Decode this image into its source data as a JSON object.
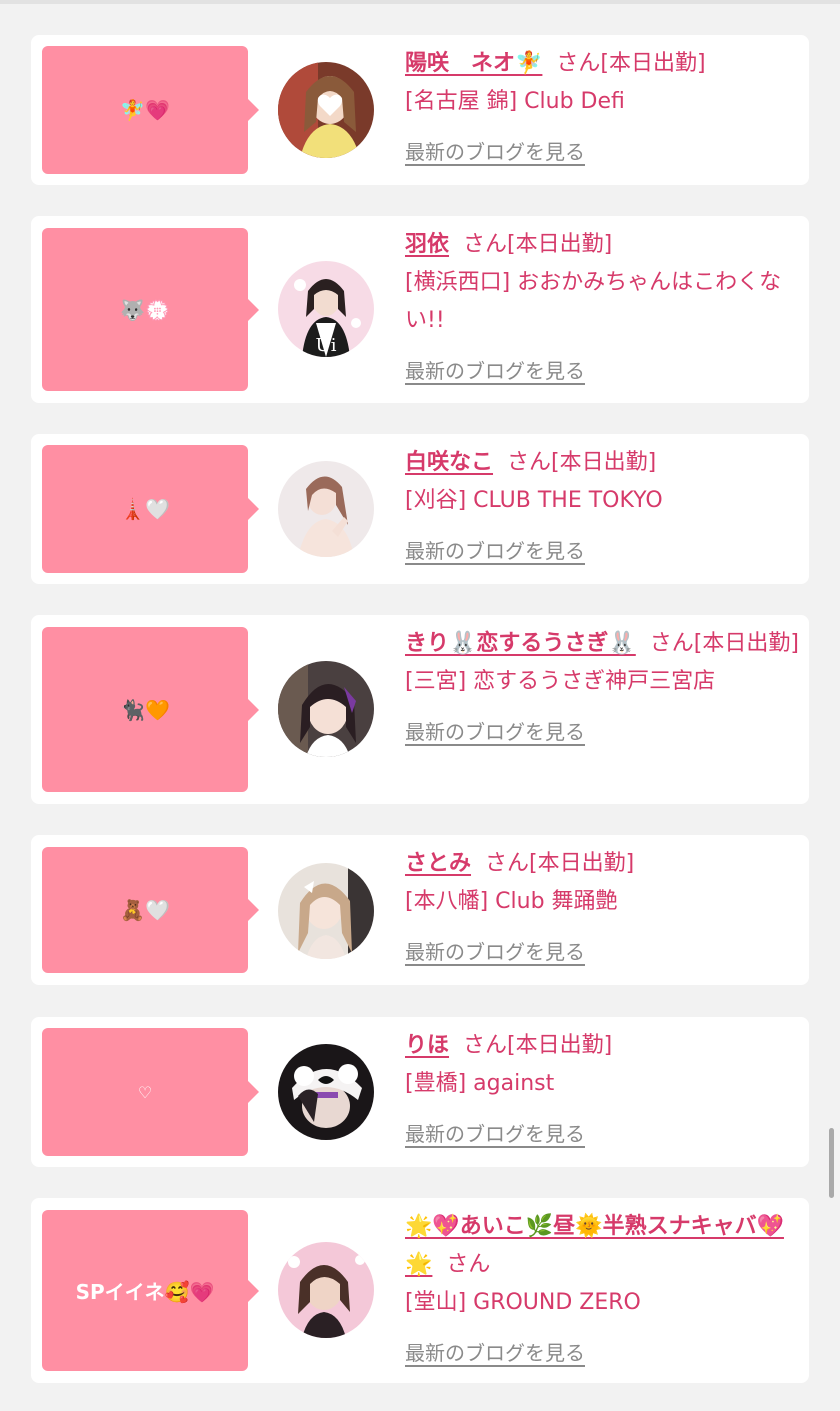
{
  "colors": {
    "accent": "#d63a6a",
    "bubble": "#ff8fa3",
    "link": "#8a8a8a",
    "background": "#f2f2f2"
  },
  "cards": [
    {
      "bubble_text": "🧚💗",
      "name": "陽咲　ネオ🧚",
      "suffix": "さん[本日出勤]",
      "shop": "[名古屋 錦] Club Defi",
      "blog_link": "最新のブログを見る"
    },
    {
      "bubble_text": "🐺💮",
      "name": "羽依",
      "suffix": "さん[本日出勤]",
      "shop": "[横浜西口] おおかみちゃんはこわくない!!",
      "blog_link": "最新のブログを見る"
    },
    {
      "bubble_text": "🗼🤍",
      "name": "白咲なこ",
      "suffix": "さん[本日出勤]",
      "shop": "[刈谷] CLUB THE TOKYO",
      "blog_link": "最新のブログを見る"
    },
    {
      "bubble_text": "🐈‍⬛🧡",
      "name": "きり🐰恋するうさぎ🐰",
      "suffix": "さん[本日出勤]",
      "shop": "[三宮] 恋するうさぎ神戸三宮店",
      "blog_link": "最新のブログを見る"
    },
    {
      "bubble_text": "🧸🤍",
      "name": "さとみ",
      "suffix": "さん[本日出勤]",
      "shop": "[本八幡] Club 舞踊艶",
      "blog_link": "最新のブログを見る"
    },
    {
      "bubble_text": "♡",
      "name": "りほ",
      "suffix": "さん[本日出勤]",
      "shop": "[豊橋] against",
      "blog_link": "最新のブログを見る"
    },
    {
      "bubble_text": "SPイイネ🥰💗",
      "name": "🌟💖あいこ🌿昼🌞半熟スナキャバ💖🌟",
      "suffix": "さん",
      "shop": "[堂山] GROUND ZERO",
      "blog_link": "最新のブログを見る"
    }
  ]
}
